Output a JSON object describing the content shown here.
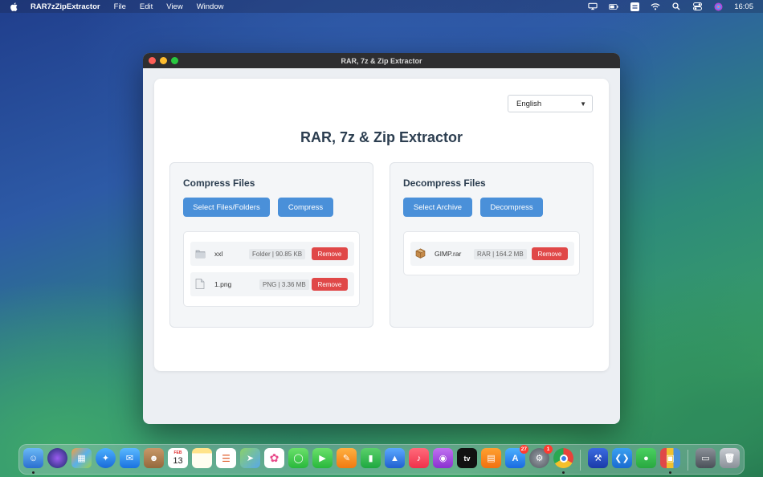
{
  "menubar": {
    "app_name": "RAR7zZipExtractor",
    "menus": [
      "File",
      "Edit",
      "View",
      "Window"
    ],
    "clock": "16:05"
  },
  "window": {
    "title": "RAR, 7z & Zip Extractor"
  },
  "app": {
    "title": "RAR, 7z & Zip Extractor",
    "language": {
      "selected": "English"
    },
    "compress": {
      "heading": "Compress Files",
      "select_label": "Select Files/Folders",
      "action_label": "Compress",
      "files": [
        {
          "name": "xxl",
          "meta": "Folder | 90.85 KB",
          "remove_label": "Remove",
          "icon": "folder-icon"
        },
        {
          "name": "1.png",
          "meta": "PNG | 3.36 MB",
          "remove_label": "Remove",
          "icon": "file-icon"
        }
      ]
    },
    "decompress": {
      "heading": "Decompress Files",
      "select_label": "Select Archive",
      "action_label": "Decompress",
      "files": [
        {
          "name": "GIMP.rar",
          "meta": "RAR | 164.2 MB",
          "remove_label": "Remove",
          "icon": "archive-box-icon"
        }
      ]
    }
  },
  "dock": {
    "calendar": {
      "month": "FEB",
      "day": "13"
    },
    "app_store_badge": "27",
    "settings_badge": "1",
    "apple_tv_label": "tv"
  },
  "colors": {
    "primary_button": "#4a90d9",
    "remove_button": "#e04848",
    "title_text": "#2c3e50"
  }
}
